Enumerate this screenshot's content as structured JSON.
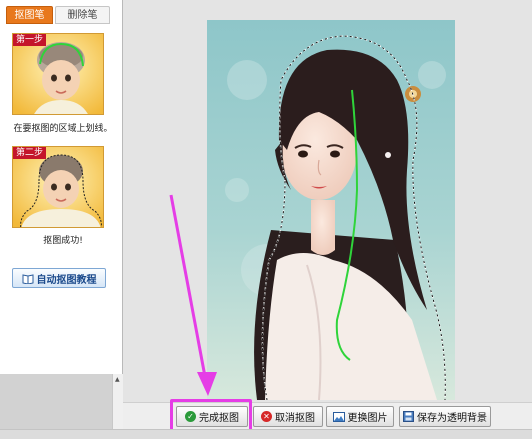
{
  "tabs": {
    "pen_label": "抠图笔",
    "eraser_label": "删除笔"
  },
  "steps": [
    {
      "badge": "第一步",
      "caption": "在要抠图的区域上划线。"
    },
    {
      "badge": "第二步",
      "caption": "抠图成功!"
    }
  ],
  "tutorial_button": {
    "label": "自动抠图教程",
    "icon": "book-icon"
  },
  "toolbar": {
    "finish_label": "完成抠图",
    "cancel_label": "取消抠图",
    "replace_label": "更换图片",
    "save_transparent_label": "保存为透明背景"
  },
  "colors": {
    "accent": "#e8781c",
    "highlight": "#e53de6",
    "annotation_arrow": "#e53de6",
    "selection_stroke": "#2fd43a",
    "step_badge": "#c4152b"
  }
}
